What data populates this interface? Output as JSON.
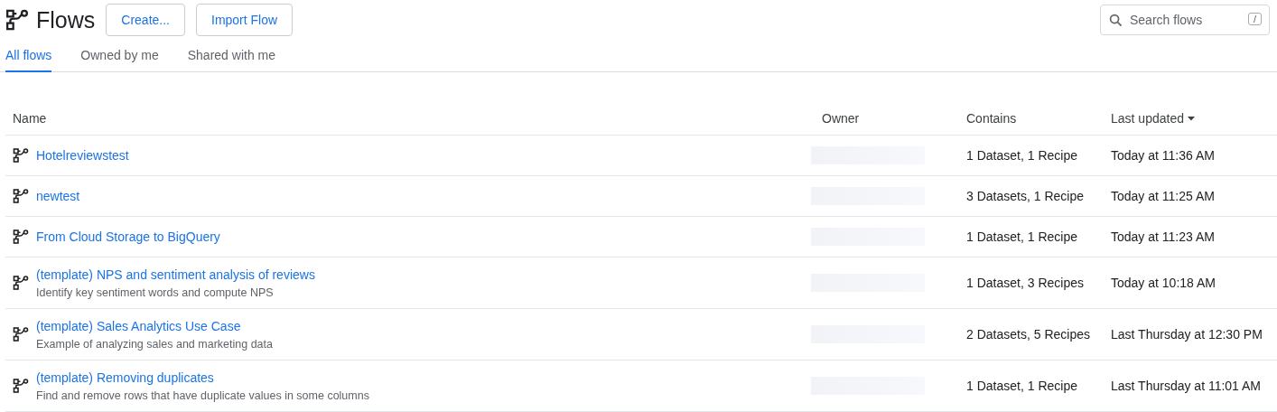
{
  "header": {
    "title": "Flows",
    "buttons": [
      "Create...",
      "Import Flow"
    ],
    "search": {
      "placeholder": "Search flows",
      "shortcut": "/"
    }
  },
  "tabs": [
    {
      "label": "All flows",
      "selected": true
    },
    {
      "label": "Owned by me",
      "selected": false
    },
    {
      "label": "Shared with me",
      "selected": false
    }
  ],
  "table": {
    "columns": [
      {
        "label": "Name",
        "sorted": false
      },
      {
        "label": "Owner",
        "sorted": false
      },
      {
        "label": "Contains",
        "sorted": false
      },
      {
        "label": "Last updated",
        "sorted": true
      }
    ],
    "rows": [
      {
        "name": "Hotelreviewstest",
        "contains": "1 Dataset, 1 Recipe",
        "last_updated": "Today at 11:36 AM"
      },
      {
        "name": "newtest",
        "contains": "3 Datasets, 1 Recipe",
        "last_updated": "Today at 11:25 AM"
      },
      {
        "name": "From Cloud Storage to BigQuery",
        "contains": "1 Dataset, 1 Recipe",
        "last_updated": "Today at 11:23 AM"
      },
      {
        "name": "(template) NPS and sentiment analysis of reviews",
        "description": "Identify key sentiment words and compute NPS",
        "contains": "1 Dataset, 3 Recipes",
        "last_updated": "Today at 10:18 AM"
      },
      {
        "name": "(template) Sales Analytics Use Case",
        "description": "Example of analyzing sales and marketing data",
        "contains": "2 Datasets, 5 Recipes",
        "last_updated": "Last Thursday at 12:30 PM"
      },
      {
        "name": "(template) Removing duplicates",
        "description": "Find and remove rows that have duplicate values in some columns",
        "contains": "1 Dataset, 1 Recipe",
        "last_updated": "Last Thursday at 11:01 AM"
      }
    ]
  }
}
